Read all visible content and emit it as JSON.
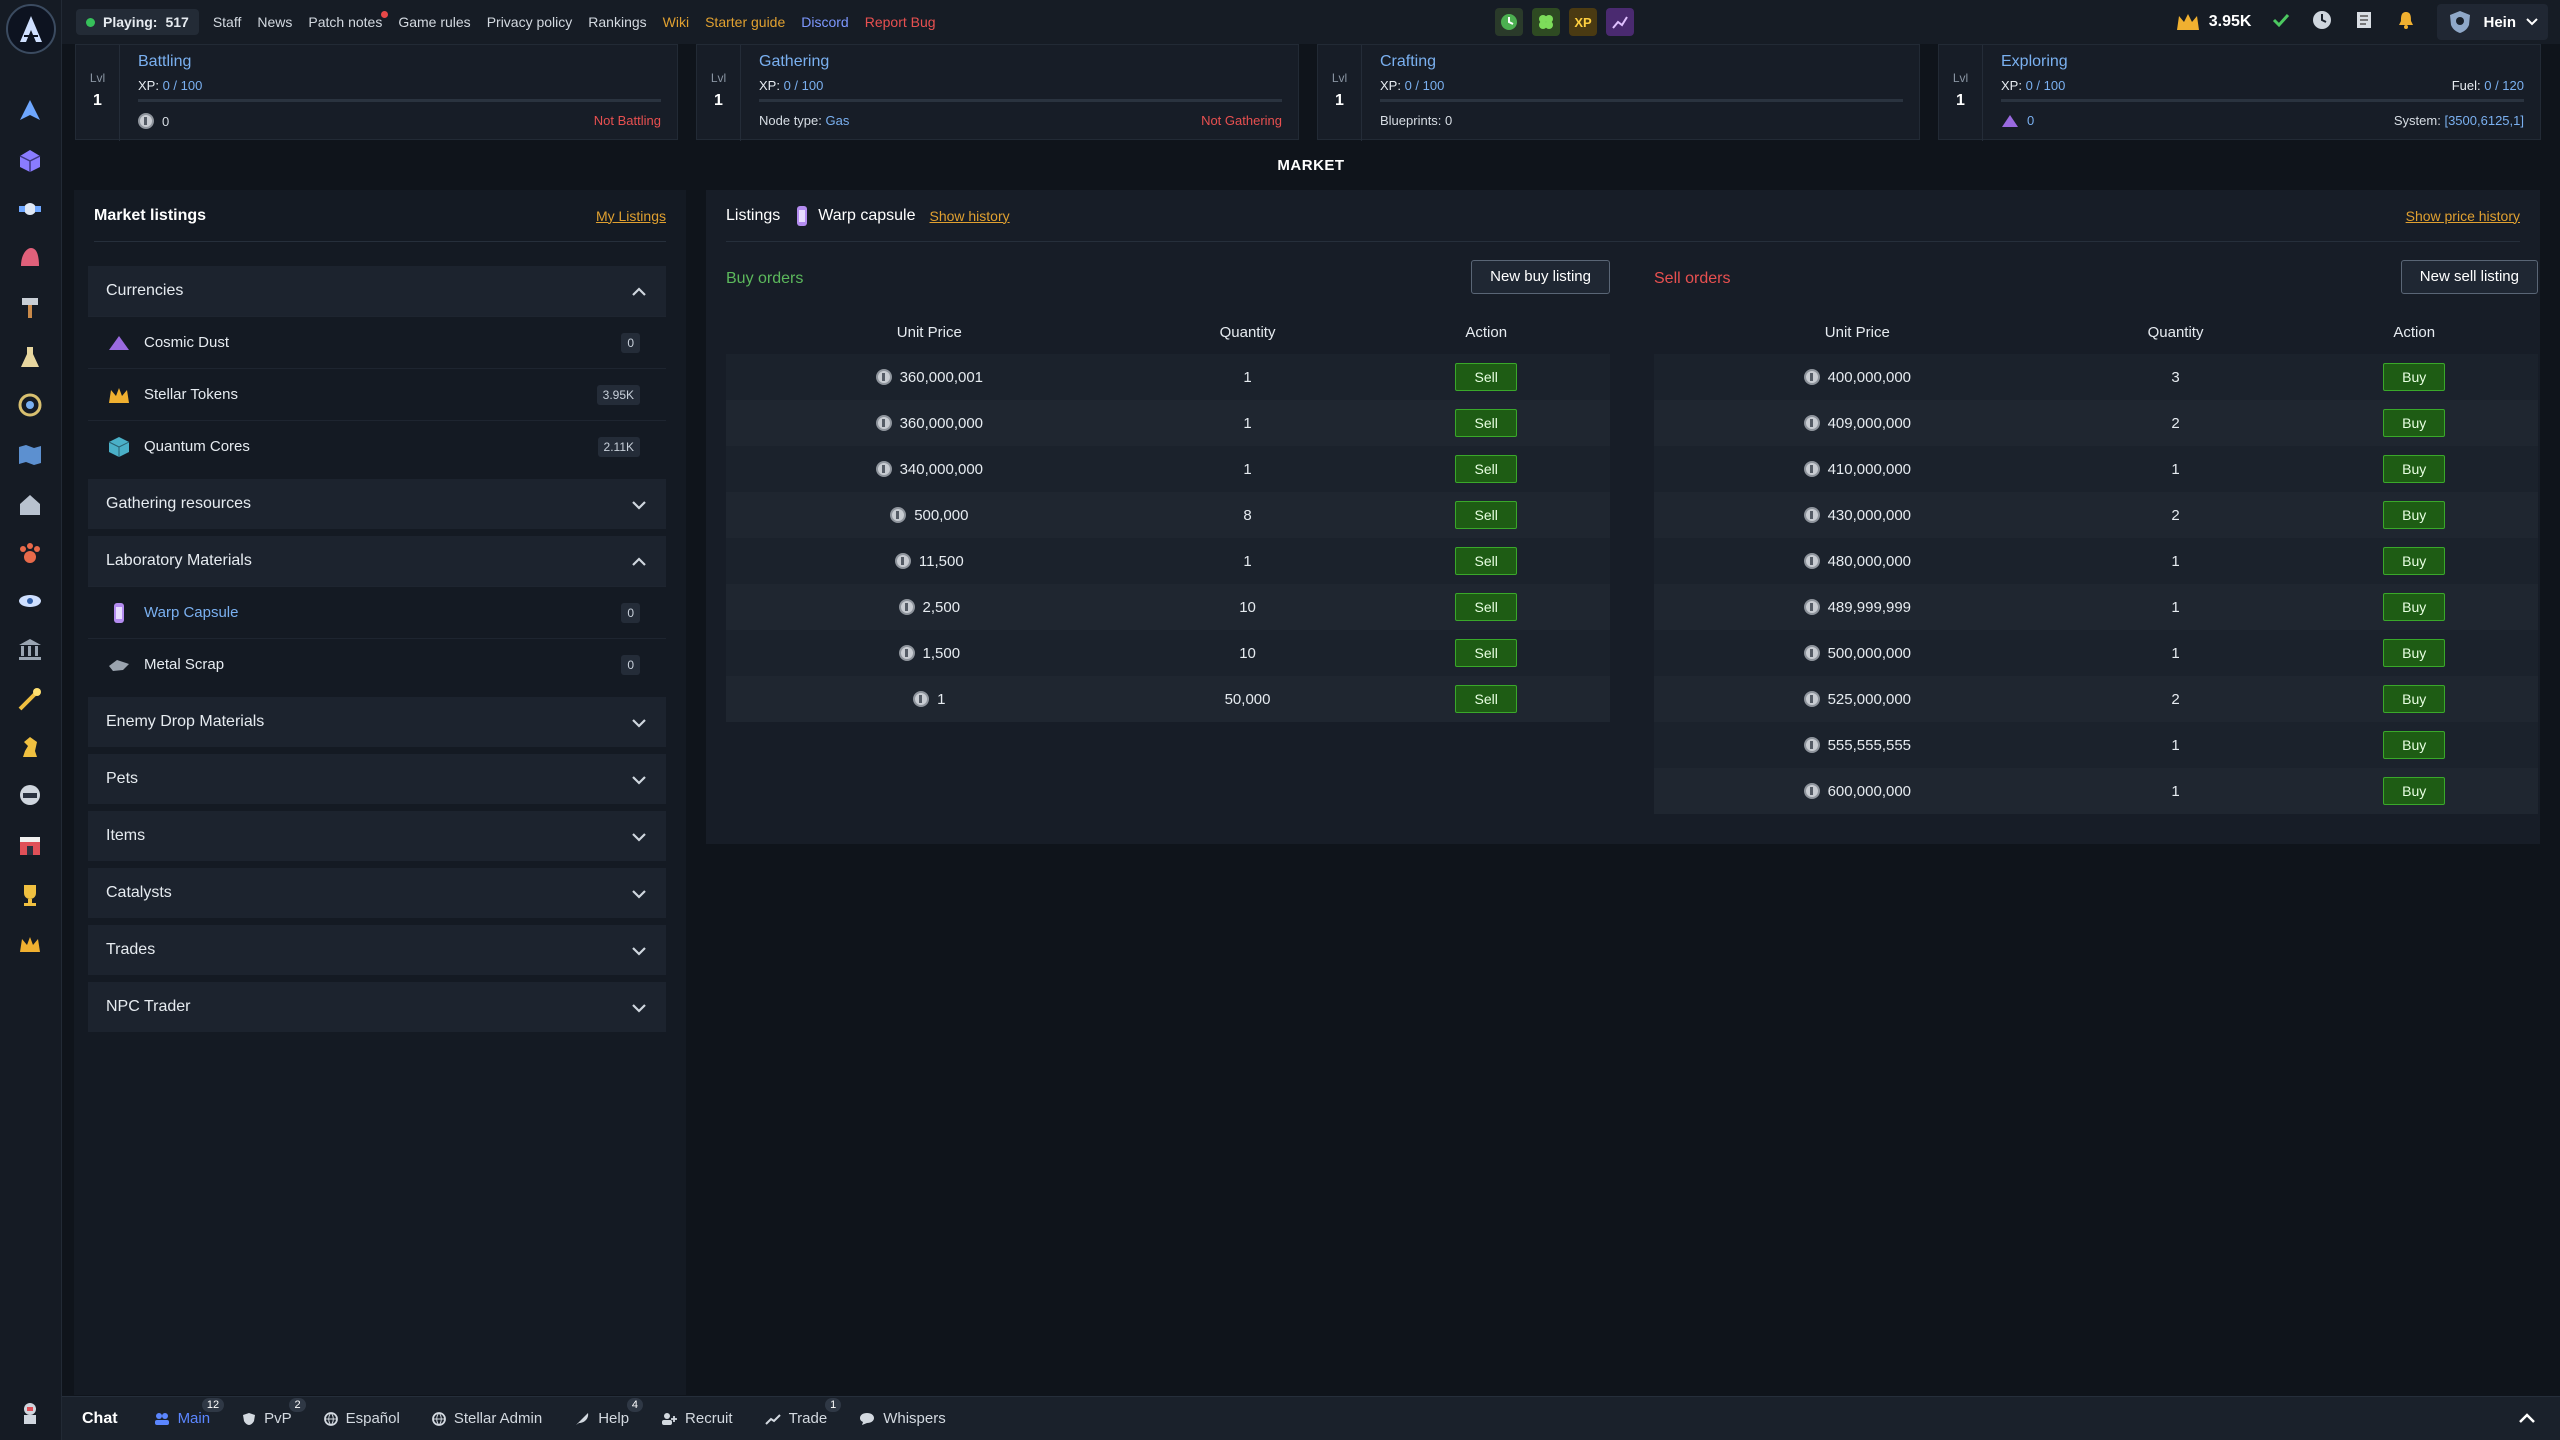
{
  "topbar": {
    "playing_label": "Playing:",
    "playing_count": "517",
    "nav": [
      {
        "label": "Staff",
        "style": "plain",
        "dot": false
      },
      {
        "label": "News",
        "style": "plain",
        "dot": false
      },
      {
        "label": "Patch notes",
        "style": "plain",
        "dot": true
      },
      {
        "label": "Game rules",
        "style": "plain",
        "dot": false
      },
      {
        "label": "Privacy policy",
        "style": "plain",
        "dot": false
      },
      {
        "label": "Rankings",
        "style": "plain",
        "dot": false
      },
      {
        "label": "Wiki",
        "style": "orange",
        "dot": false
      },
      {
        "label": "Starter guide",
        "style": "orange",
        "dot": false
      },
      {
        "label": "Discord",
        "style": "blue",
        "dot": false
      },
      {
        "label": "Report Bug",
        "style": "red",
        "dot": false
      }
    ],
    "quick_xp_label": "XP",
    "tokens": "3.95K",
    "username": "Hein"
  },
  "skills": [
    {
      "lvl_label": "Lvl",
      "lvl": "1",
      "name": "Battling",
      "xp_label": "XP:",
      "xp": "0 / 100",
      "left_value": "0",
      "right_value": "Not Battling",
      "extra": ""
    },
    {
      "lvl_label": "Lvl",
      "lvl": "1",
      "name": "Gathering",
      "xp_label": "XP:",
      "xp": "0 / 100",
      "left_label": "Node type:",
      "left_value": "Gas",
      "right_value": "Not Gathering",
      "extra": ""
    },
    {
      "lvl_label": "Lvl",
      "lvl": "1",
      "name": "Crafting",
      "xp_label": "XP:",
      "xp": "0 / 100",
      "left_label": "Blueprints:",
      "left_value": "0",
      "right_value": "",
      "extra": ""
    },
    {
      "lvl_label": "Lvl",
      "lvl": "1",
      "name": "Exploring",
      "xp_label": "XP:",
      "xp": "0 / 100",
      "fuel_label": "Fuel:",
      "fuel": "0 / 120",
      "left_value": "0",
      "system_label": "System:",
      "system": "[3500,6125,1]"
    }
  ],
  "market": {
    "title": "MARKET",
    "listings_title": "Market listings",
    "my_listings": "My Listings",
    "categories": [
      {
        "label": "Currencies",
        "expanded": true,
        "items": [
          {
            "name": "Cosmic Dust",
            "count": "0",
            "icon": "cosmic-dust-icon",
            "selected": false
          },
          {
            "name": "Stellar Tokens",
            "count": "3.95K",
            "icon": "stellar-tokens-icon",
            "selected": false
          },
          {
            "name": "Quantum Cores",
            "count": "2.11K",
            "icon": "quantum-cores-icon",
            "selected": false
          }
        ]
      },
      {
        "label": "Gathering resources",
        "expanded": false,
        "items": []
      },
      {
        "label": "Laboratory Materials",
        "expanded": true,
        "items": [
          {
            "name": "Warp Capsule",
            "count": "0",
            "icon": "warp-capsule-icon",
            "selected": true
          },
          {
            "name": "Metal Scrap",
            "count": "0",
            "icon": "metal-scrap-icon",
            "selected": false
          }
        ]
      },
      {
        "label": "Enemy Drop Materials",
        "expanded": false,
        "items": []
      },
      {
        "label": "Pets",
        "expanded": false,
        "items": []
      },
      {
        "label": "Items",
        "expanded": false,
        "items": []
      },
      {
        "label": "Catalysts",
        "expanded": false,
        "items": []
      },
      {
        "label": "Trades",
        "expanded": false,
        "items": []
      },
      {
        "label": "NPC Trader",
        "expanded": false,
        "items": []
      }
    ]
  },
  "listings": {
    "title": "Listings",
    "item_name": "Warp capsule",
    "show_history": "Show history",
    "show_price_history": "Show price history",
    "buy": {
      "title": "Buy orders",
      "new_button": "New buy listing",
      "headers": [
        "Unit Price",
        "Quantity",
        "Action"
      ],
      "action_label": "Sell",
      "rows": [
        {
          "price": "360,000,001",
          "qty": "1"
        },
        {
          "price": "360,000,000",
          "qty": "1"
        },
        {
          "price": "340,000,000",
          "qty": "1"
        },
        {
          "price": "500,000",
          "qty": "8"
        },
        {
          "price": "11,500",
          "qty": "1"
        },
        {
          "price": "2,500",
          "qty": "10"
        },
        {
          "price": "1,500",
          "qty": "10"
        },
        {
          "price": "1",
          "qty": "50,000"
        }
      ]
    },
    "sell": {
      "title": "Sell orders",
      "new_button": "New sell listing",
      "headers": [
        "Unit Price",
        "Quantity",
        "Action"
      ],
      "action_label": "Buy",
      "rows": [
        {
          "price": "400,000,000",
          "qty": "3"
        },
        {
          "price": "409,000,000",
          "qty": "2"
        },
        {
          "price": "410,000,000",
          "qty": "1"
        },
        {
          "price": "430,000,000",
          "qty": "2"
        },
        {
          "price": "480,000,000",
          "qty": "1"
        },
        {
          "price": "489,999,999",
          "qty": "1"
        },
        {
          "price": "500,000,000",
          "qty": "1"
        },
        {
          "price": "525,000,000",
          "qty": "2"
        },
        {
          "price": "555,555,555",
          "qty": "1"
        },
        {
          "price": "600,000,000",
          "qty": "1"
        }
      ]
    }
  },
  "chat": {
    "title": "Chat",
    "tabs": [
      {
        "label": "Main",
        "count": "12",
        "icon": "users-icon",
        "active": true
      },
      {
        "label": "PvP",
        "count": "2",
        "icon": "shield-icon",
        "active": false
      },
      {
        "label": "Español",
        "count": "",
        "icon": "globe-icon",
        "active": false
      },
      {
        "label": "Stellar Admin",
        "count": "",
        "icon": "globe-icon",
        "active": false
      },
      {
        "label": "Help",
        "count": "4",
        "icon": "feather-icon",
        "active": false
      },
      {
        "label": "Recruit",
        "count": "",
        "icon": "user-plus-icon",
        "active": false
      },
      {
        "label": "Trade",
        "count": "1",
        "icon": "trend-icon",
        "active": false
      },
      {
        "label": "Whispers",
        "count": "",
        "icon": "speech-bubble-icon",
        "active": false
      }
    ]
  },
  "colors": {
    "accent_blue": "#7ab0f0",
    "buy_green": "#5cb85c",
    "sell_red": "#e85050",
    "link_orange": "#e0a030"
  }
}
